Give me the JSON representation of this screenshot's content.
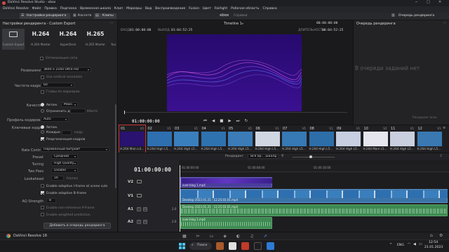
{
  "window": {
    "title": "DaVinci Resolve Studio - xbox"
  },
  "menu": [
    "DaVinci Resolve",
    "Файл",
    "Правка",
    "Подгонка",
    "Временная шкала",
    "Клип",
    "Маркеры",
    "Вид",
    "Воспроизведение",
    "Fusion",
    "Цвет",
    "Fairlight",
    "Рабочая область",
    "Справка"
  ],
  "toolbar": {
    "render_settings": "Настройки рендеринга",
    "cassette": "Кассета",
    "clips": "Клипы",
    "project": "xbox",
    "status": "Справки",
    "queue_btn": "Очередь рендеринга"
  },
  "left_panel": {
    "title": "Настройки рендеринга - Custom Export",
    "presets": [
      {
        "name": "",
        "sub": "Custom Export"
      },
      {
        "name": "H.264",
        "sub": "H.264 Master"
      },
      {
        "name": "H.264",
        "sub": "HyperDeck"
      },
      {
        "name": "H.265",
        "sub": "H.265 Master"
      },
      {
        "name": "",
        "sub": "You"
      }
    ],
    "optimized": "Оптимизация сети",
    "resolution_label": "Разрешение",
    "resolution_value": "3840 x 2160 Ultra HD",
    "vertical_res": "Use vertical resolution",
    "fps_label": "Частота кадров",
    "fps_value": "60",
    "chapters": "Главы по маркерам",
    "quality_label": "Качество",
    "quality_auto": "Автом.",
    "quality_max": "Макс.",
    "limit_label": "Ограничить до",
    "limit_unit": "Кбит/с",
    "profile_label": "Профиль кодиров...",
    "profile_value": "Auto",
    "keyframes_label": "Ключевые кадры",
    "kf_auto": "Автом.",
    "kf_every": "Каждые",
    "kf_every_unit": "кадр.",
    "reorder": "Реорганизация кадров",
    "rate_label": "Rate Control",
    "rate_value": "Переменный битрейт",
    "preset_label": "Preset",
    "preset_value": "Средний",
    "tuning_label": "Tuning",
    "tuning_value": "High Quality",
    "two_pass_label": "Two Pass",
    "two_pass_value": "Disable",
    "lookahead_label": "Lookahead",
    "lookahead_value": "16",
    "lookahead_unit": "frames",
    "adaptive_i": "Enable adaptive I-frame at scene cuts",
    "adaptive_b": "Enable adaptive B-frame",
    "aq_label": "AQ Strength",
    "aq_value": "8",
    "nonref": "Enable non-reference P-frame",
    "weighted": "Enable weighted prediction",
    "add_queue": "Добавить в очередь рендеринга"
  },
  "viewer": {
    "in_label": "ВХОД",
    "in_tc": "01:00:00:00",
    "out_label": "ВЫХОД",
    "out_tc": "01:04:52:25",
    "timeline_name": "Timeline 1",
    "duration_label": "ДЛИТЕЛЬНОСТЬ",
    "duration_tc": "00:04:52:25",
    "top_tc": "00:00:00:00",
    "current_tc": "01:00:00:00"
  },
  "queue": {
    "title": "Очередь рендеринга",
    "empty": "В очереди заданий нет",
    "render_btn": "Рендеринг всех"
  },
  "clips": [
    {
      "num": "01",
      "v": "V2",
      "cap": "H.264 Main L4...",
      "color": "#2a1270"
    },
    {
      "num": "02",
      "v": "V1",
      "cap": "H.264 High L5...",
      "color": "#2e6fb0"
    },
    {
      "num": "03",
      "v": "V1",
      "cap": "H.264 High L5...",
      "color": "#3a7fbd"
    },
    {
      "num": "04",
      "v": "V1",
      "cap": "H.264 High L5...",
      "color": "#2f72b0"
    },
    {
      "num": "05",
      "v": "V1",
      "cap": "H.264 High L5...",
      "color": "#3b7cb8"
    },
    {
      "num": "06",
      "v": "V1",
      "cap": "H.264 High L5...",
      "color": "#d0d6e2"
    },
    {
      "num": "07",
      "v": "V1",
      "cap": "H.264 High L5...",
      "color": "#3679b4"
    },
    {
      "num": "08",
      "v": "V1",
      "cap": "H.264 High L5...",
      "color": "#2d6ea9"
    },
    {
      "num": "09",
      "v": "V1",
      "cap": "H.264 High L5...",
      "color": "#c7cfe0"
    },
    {
      "num": "10",
      "v": "V2",
      "cap": "H.264 Main L5...",
      "color": "#e6e6ee"
    },
    {
      "num": "11",
      "v": "V1",
      "cap": "H.264 High L5...",
      "color": "#c9cfde"
    },
    {
      "num": "12",
      "v": "V1",
      "cap": "H.264 High L5...",
      "color": "#3a78b2"
    }
  ],
  "timeline": {
    "tc": "01:00:00:00",
    "render_label": "Рендеринг",
    "range_value": "Вся вр... шкала",
    "ruler": [
      "01:00:00:00",
      "01:00:08:00",
      "01:00:16:00"
    ],
    "tracks": [
      {
        "id": "V2",
        "clip": "over-blog 1.mp4"
      },
      {
        "id": "V1",
        "clip": "Desktop 2023.01.21 - 12.25.03.01.mp4"
      },
      {
        "id": "A1",
        "level": "2.0",
        "clip": "Desktop 2023.01.21 - 12.25.03.01.mp4"
      },
      {
        "id": "A2",
        "level": "2.0",
        "clip": "over-blog 1.mp4"
      }
    ]
  },
  "resolve_bar": {
    "app": "DaVinci Resolve 18"
  },
  "taskbar": {
    "search": "Поиск",
    "lang": "ENG",
    "time": "12:54",
    "date": "21.01.2023"
  },
  "colors": {
    "accent_blue": "#3f6fb4",
    "video_purple": "#2a0a73",
    "audio_green": "#3e8a52",
    "v2_clip": "#4a3e9c",
    "v1_clip": "#3b73a6"
  }
}
